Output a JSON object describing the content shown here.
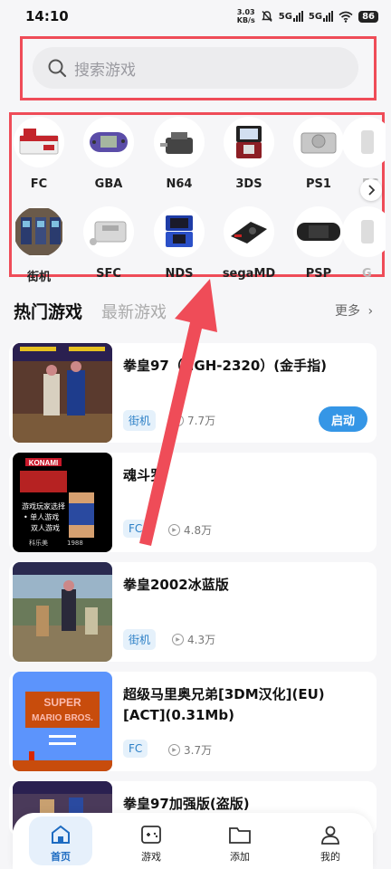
{
  "status_bar": {
    "time": "14:10",
    "net_speed_value": "3.03",
    "net_speed_unit": "KB/s",
    "sim1": "5G",
    "sim2": "5G",
    "battery": "86"
  },
  "search": {
    "placeholder": "搜索游戏"
  },
  "consoles": [
    "FC",
    "GBA",
    "N64",
    "3DS",
    "PS1",
    "FC",
    "街机",
    "SFC",
    "NDS",
    "segaMD",
    "PSP",
    "G"
  ],
  "section": {
    "hot_tab": "热门游戏",
    "new_tab": "最新游戏",
    "more": "更多"
  },
  "games": [
    {
      "title": "拳皇97（NGH-2320）(金手指)",
      "tag": "街机",
      "plays": "7.7万",
      "action": "启动"
    },
    {
      "title": "魂斗罗",
      "tag": "FC",
      "plays": "4.8万"
    },
    {
      "title": "拳皇2002冰蓝版",
      "tag": "街机",
      "plays": "4.3万"
    },
    {
      "title": "超级马里奥兄弟[3DM汉化](EU)[ACT](0.31Mb)",
      "tag": "FC",
      "plays": "3.7万"
    },
    {
      "title": "拳皇97加强版(盗版)"
    }
  ],
  "bottom_nav": [
    "首页",
    "游戏",
    "添加",
    "我的"
  ],
  "thumb_text": {
    "konami": "KONAMI",
    "contra_menu": "游戏玩家选择",
    "one_player": "单人游戏",
    "two_player": "双人游戏",
    "publisher": "科乐美",
    "year": "1988",
    "super_mario": "SUPER",
    "mario_bros": "MARIO BROS."
  },
  "colors": {
    "accent": "#3596e6",
    "annotation": "#ef4c58",
    "active_nav": "#1d6bc1",
    "tag_text": "#2b7fc6"
  }
}
